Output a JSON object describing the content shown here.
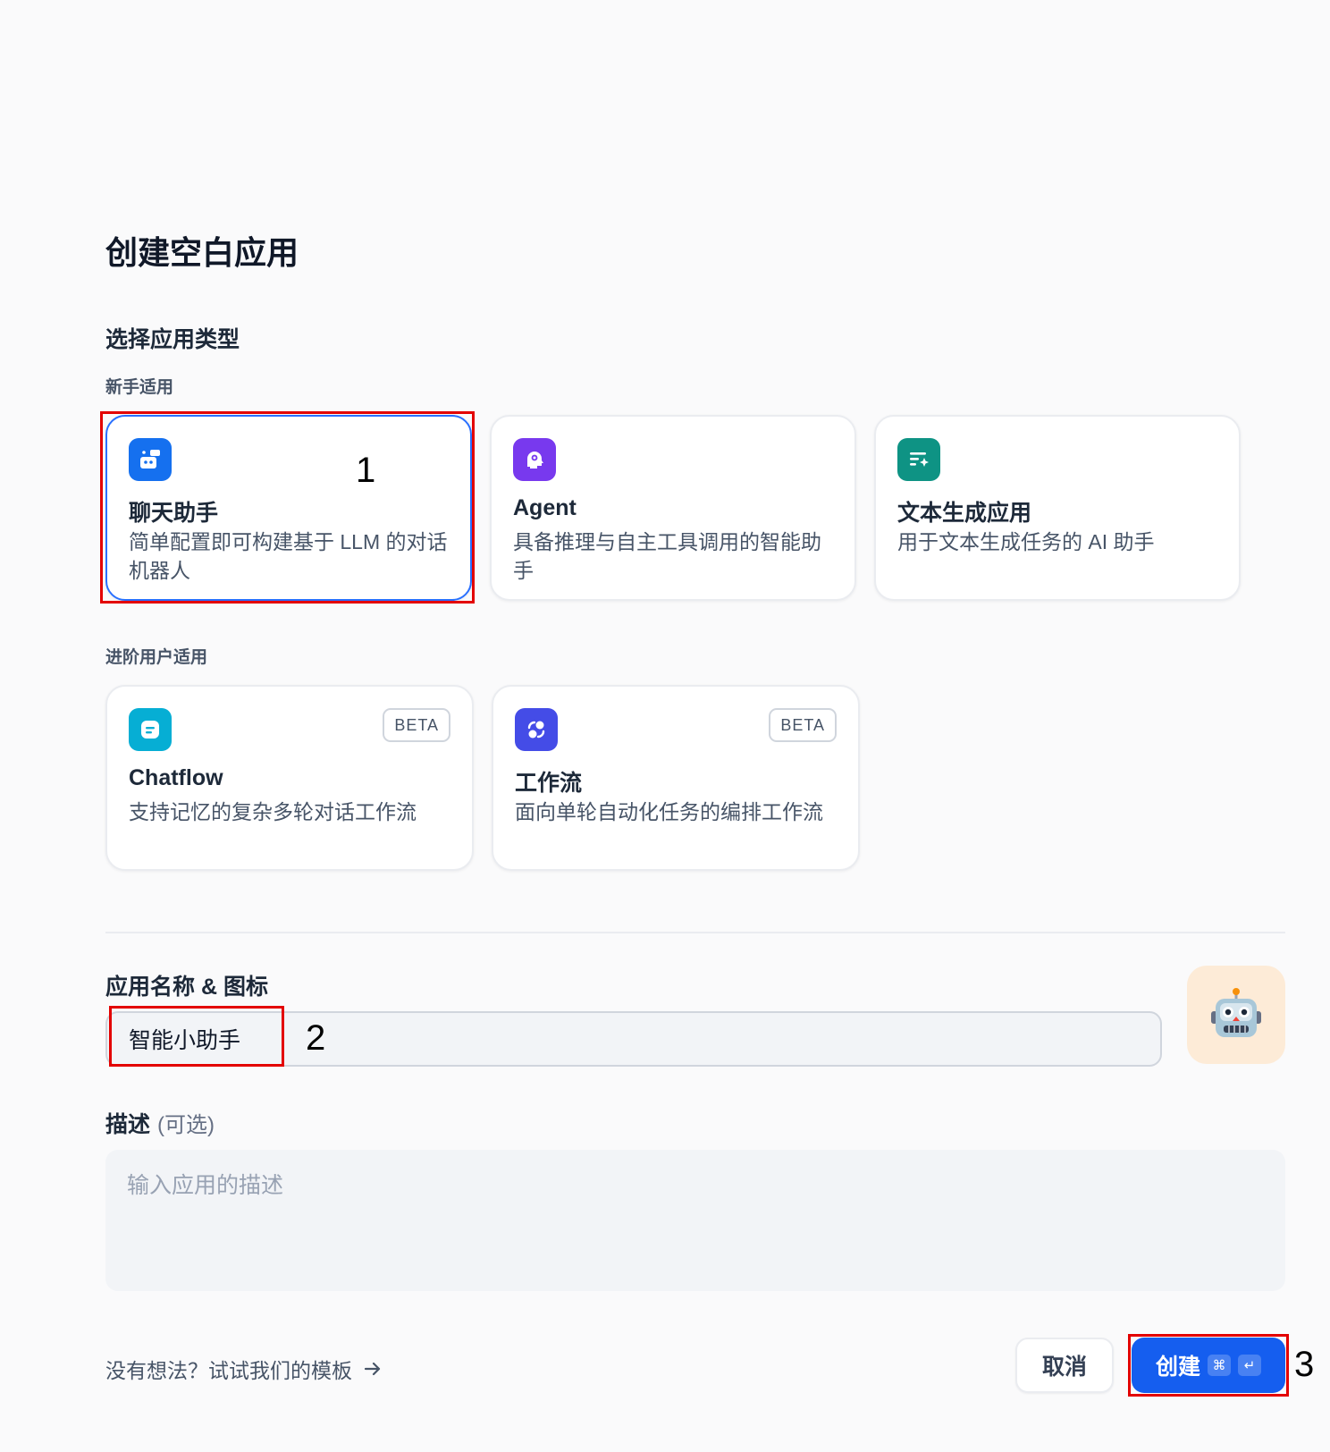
{
  "dialog": {
    "title": "创建空白应用",
    "section_title": "选择应用类型",
    "group_beginner": "新手适用",
    "group_advanced": "进阶用户适用"
  },
  "app_types": [
    {
      "title": "聊天助手",
      "desc": "简单配置即可构建基于 LLM 的对话机器人",
      "icon": "chat-bot-icon",
      "color": "#1570ef",
      "selected": true
    },
    {
      "title": "Agent",
      "desc": "具备推理与自主工具调用的智能助手",
      "icon": "agent-brain-icon",
      "color": "#7839ee"
    },
    {
      "title": "文本生成应用",
      "desc": "用于文本生成任务的 AI 助手",
      "icon": "text-generation-icon",
      "color": "#0e9384"
    },
    {
      "title": "Chatflow",
      "desc": "支持记忆的复杂多轮对话工作流",
      "icon": "chatflow-icon",
      "color": "#06aed4",
      "badge": "BETA"
    },
    {
      "title": "工作流",
      "desc": "面向单轮自动化任务的编排工作流",
      "icon": "workflow-icon",
      "color": "#444ce7",
      "badge": "BETA"
    }
  ],
  "form": {
    "name_label": "应用名称 & 图标",
    "name_value": "智能小助手",
    "avatar_icon": "robot-emoji-icon",
    "avatar_bg": "#fdebd7",
    "desc_label": "描述",
    "desc_optional": "(可选)",
    "desc_placeholder": "输入应用的描述"
  },
  "footer": {
    "template_link": "没有想法？试试我们的模板",
    "cancel_label": "取消",
    "create_label": "创建",
    "create_kbd_1": "⌘",
    "create_kbd_2": "↵"
  },
  "annotations": [
    "1",
    "2",
    "3"
  ]
}
